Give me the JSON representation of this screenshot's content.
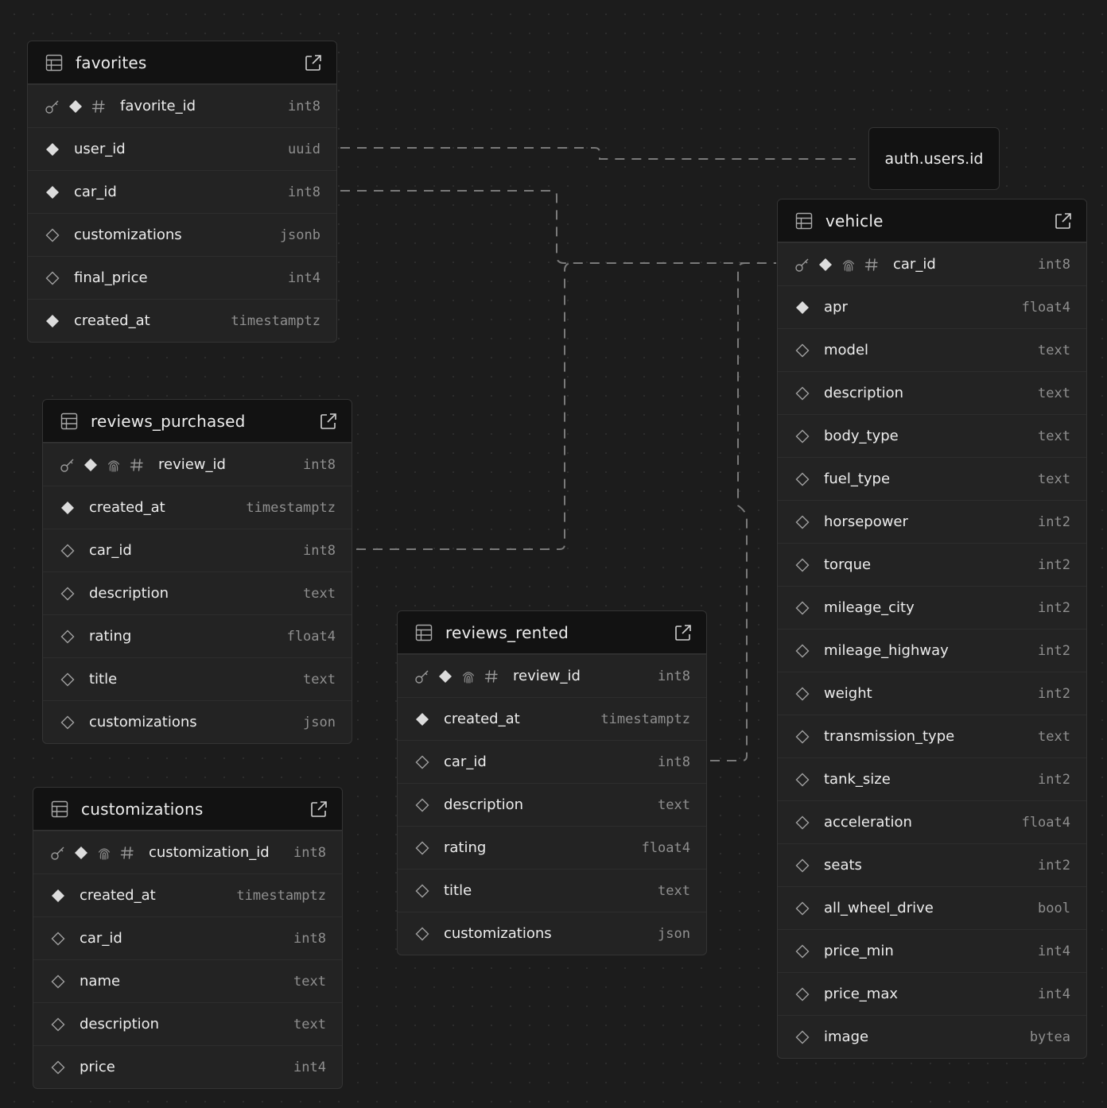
{
  "external_node": {
    "label": "auth.users.id"
  },
  "tables": [
    {
      "key": "favorites",
      "name": "favorites",
      "columns": [
        {
          "name": "favorite_id",
          "type": "int8",
          "flags": [
            "key",
            "required",
            "hash"
          ]
        },
        {
          "name": "user_id",
          "type": "uuid",
          "flags": [
            "required"
          ]
        },
        {
          "name": "car_id",
          "type": "int8",
          "flags": [
            "required"
          ]
        },
        {
          "name": "customizations",
          "type": "jsonb",
          "flags": [
            "nullable"
          ]
        },
        {
          "name": "final_price",
          "type": "int4",
          "flags": [
            "nullable"
          ]
        },
        {
          "name": "created_at",
          "type": "timestamptz",
          "flags": [
            "required"
          ]
        }
      ]
    },
    {
      "key": "reviews_purchased",
      "name": "reviews_purchased",
      "columns": [
        {
          "name": "review_id",
          "type": "int8",
          "flags": [
            "key",
            "required",
            "unique",
            "hash"
          ]
        },
        {
          "name": "created_at",
          "type": "timestamptz",
          "flags": [
            "required"
          ]
        },
        {
          "name": "car_id",
          "type": "int8",
          "flags": [
            "nullable"
          ]
        },
        {
          "name": "description",
          "type": "text",
          "flags": [
            "nullable"
          ]
        },
        {
          "name": "rating",
          "type": "float4",
          "flags": [
            "nullable"
          ]
        },
        {
          "name": "title",
          "type": "text",
          "flags": [
            "nullable"
          ]
        },
        {
          "name": "customizations",
          "type": "json",
          "flags": [
            "nullable"
          ]
        }
      ]
    },
    {
      "key": "customizations",
      "name": "customizations",
      "columns": [
        {
          "name": "customization_id",
          "type": "int8",
          "flags": [
            "key",
            "required",
            "unique",
            "hash"
          ]
        },
        {
          "name": "created_at",
          "type": "timestamptz",
          "flags": [
            "required"
          ]
        },
        {
          "name": "car_id",
          "type": "int8",
          "flags": [
            "nullable"
          ]
        },
        {
          "name": "name",
          "type": "text",
          "flags": [
            "nullable"
          ]
        },
        {
          "name": "description",
          "type": "text",
          "flags": [
            "nullable"
          ]
        },
        {
          "name": "price",
          "type": "int4",
          "flags": [
            "nullable"
          ]
        }
      ]
    },
    {
      "key": "reviews_rented",
      "name": "reviews_rented",
      "columns": [
        {
          "name": "review_id",
          "type": "int8",
          "flags": [
            "key",
            "required",
            "unique",
            "hash"
          ]
        },
        {
          "name": "created_at",
          "type": "timestamptz",
          "flags": [
            "required"
          ]
        },
        {
          "name": "car_id",
          "type": "int8",
          "flags": [
            "nullable"
          ]
        },
        {
          "name": "description",
          "type": "text",
          "flags": [
            "nullable"
          ]
        },
        {
          "name": "rating",
          "type": "float4",
          "flags": [
            "nullable"
          ]
        },
        {
          "name": "title",
          "type": "text",
          "flags": [
            "nullable"
          ]
        },
        {
          "name": "customizations",
          "type": "json",
          "flags": [
            "nullable"
          ]
        }
      ]
    },
    {
      "key": "vehicle",
      "name": "vehicle",
      "columns": [
        {
          "name": "car_id",
          "type": "int8",
          "flags": [
            "key",
            "required",
            "unique",
            "hash"
          ]
        },
        {
          "name": "apr",
          "type": "float4",
          "flags": [
            "required"
          ]
        },
        {
          "name": "model",
          "type": "text",
          "flags": [
            "nullable"
          ]
        },
        {
          "name": "description",
          "type": "text",
          "flags": [
            "nullable"
          ]
        },
        {
          "name": "body_type",
          "type": "text",
          "flags": [
            "nullable"
          ]
        },
        {
          "name": "fuel_type",
          "type": "text",
          "flags": [
            "nullable"
          ]
        },
        {
          "name": "horsepower",
          "type": "int2",
          "flags": [
            "nullable"
          ]
        },
        {
          "name": "torque",
          "type": "int2",
          "flags": [
            "nullable"
          ]
        },
        {
          "name": "mileage_city",
          "type": "int2",
          "flags": [
            "nullable"
          ]
        },
        {
          "name": "mileage_highway",
          "type": "int2",
          "flags": [
            "nullable"
          ]
        },
        {
          "name": "weight",
          "type": "int2",
          "flags": [
            "nullable"
          ]
        },
        {
          "name": "transmission_type",
          "type": "text",
          "flags": [
            "nullable"
          ]
        },
        {
          "name": "tank_size",
          "type": "int2",
          "flags": [
            "nullable"
          ]
        },
        {
          "name": "acceleration",
          "type": "float4",
          "flags": [
            "nullable"
          ]
        },
        {
          "name": "seats",
          "type": "int2",
          "flags": [
            "nullable"
          ]
        },
        {
          "name": "all_wheel_drive",
          "type": "bool",
          "flags": [
            "nullable"
          ]
        },
        {
          "name": "price_min",
          "type": "int4",
          "flags": [
            "nullable"
          ]
        },
        {
          "name": "price_max",
          "type": "int4",
          "flags": [
            "nullable"
          ]
        },
        {
          "name": "image",
          "type": "bytea",
          "flags": [
            "nullable"
          ]
        }
      ]
    }
  ],
  "relations": [
    {
      "from": "favorites.user_id",
      "to": "auth.users.id"
    },
    {
      "from": "favorites.car_id",
      "to": "vehicle.car_id"
    },
    {
      "from": "reviews_purchased.car_id",
      "to": "vehicle.car_id"
    },
    {
      "from": "reviews_rented.car_id",
      "to": "vehicle.car_id"
    }
  ],
  "colors": {
    "background": "#1c1c1c",
    "panel": "#232323",
    "header": "#121212",
    "border": "#343434",
    "edge": "#7a7a7a",
    "type_text": "#8f8f8f"
  }
}
